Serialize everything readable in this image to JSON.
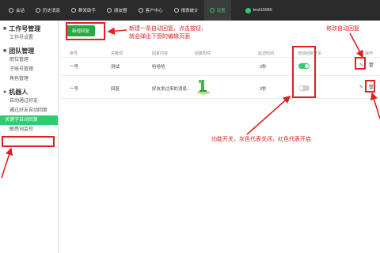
{
  "topnav": {
    "items": [
      {
        "label": "会话",
        "icon": "chat-icon"
      },
      {
        "label": "历史消息",
        "icon": "history-icon"
      },
      {
        "label": "群发助手",
        "icon": "broadcast-icon"
      },
      {
        "label": "朋友圈",
        "icon": "moments-icon"
      },
      {
        "label": "客户中心",
        "icon": "customer-icon"
      },
      {
        "label": "报表统计",
        "icon": "report-icon"
      },
      {
        "label": "设置",
        "icon": "settings-icon"
      }
    ],
    "active": "设置",
    "user": "test10086"
  },
  "sidebar": {
    "sections": [
      {
        "title": "工作号管理",
        "icon": "square-icon",
        "items": [
          "工作号设置"
        ]
      },
      {
        "title": "团队管理",
        "icon": "team-icon",
        "items": [
          "职位管理",
          "子账号管理",
          "角色管理"
        ]
      },
      {
        "title": "机器人",
        "icon": "robot-icon",
        "items": [
          "自动通过好友",
          "通过好友自动回复",
          "关键字自动回复",
          "敏感词监控"
        ]
      }
    ],
    "active_item": "关键字自动回复"
  },
  "main": {
    "new_button": "新增回复",
    "table": {
      "headers": [
        "序号",
        "关键词",
        "回复内容",
        "回复附件",
        "延迟时间",
        "自动回复开关",
        "操作"
      ],
      "rows": [
        {
          "index": "一号",
          "keyword": "测试",
          "content": "哈哈哈",
          "attachment": "",
          "delay": "3秒",
          "enabled": true
        },
        {
          "index": "一号",
          "keyword": "回复",
          "content": "好友发过来的消息...",
          "attachment": "image-thumbnail",
          "delay": "3秒",
          "enabled": false
        }
      ]
    }
  },
  "annotations": {
    "new_btn_note_line1": "新建一条自动回复，点击按钮，",
    "new_btn_note_line2": "就会弹出下图的编辑页面",
    "edit_note": "修改自动回复",
    "toggle_note": "功能开关，灰色代表关闭，红色代表开启"
  },
  "colors": {
    "accent": "#2ecc71",
    "button": "#28a745",
    "annotation": "#e02020",
    "topbar": "#2b2b2b"
  }
}
